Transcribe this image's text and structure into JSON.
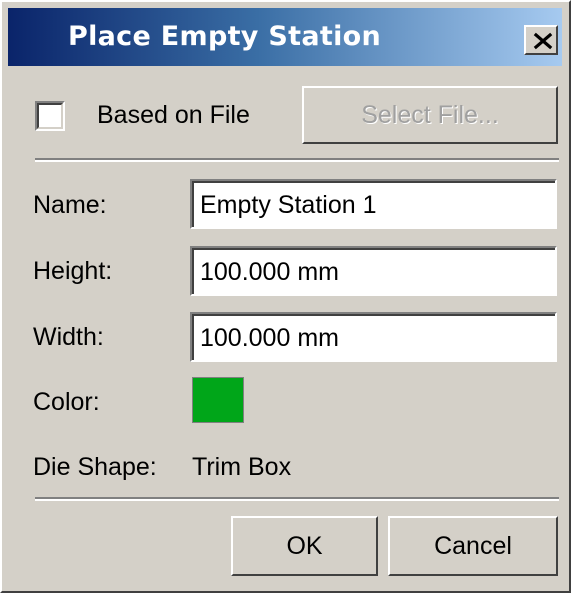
{
  "window": {
    "title": "Place Empty Station",
    "close_icon": "close-icon"
  },
  "based_on_file": {
    "label": "Based on File",
    "checked": false
  },
  "select_file_button": {
    "label": "Select File...",
    "enabled": false
  },
  "fields": {
    "name": {
      "label": "Name:",
      "value": "Empty Station 1"
    },
    "height": {
      "label": "Height:",
      "value": "100.000 mm"
    },
    "width": {
      "label": "Width:",
      "value": "100.000 mm"
    }
  },
  "color": {
    "label": "Color:",
    "value": "#00a619"
  },
  "die_shape": {
    "label": "Die Shape:",
    "value": "Trim Box"
  },
  "buttons": {
    "ok": "OK",
    "cancel": "Cancel"
  }
}
